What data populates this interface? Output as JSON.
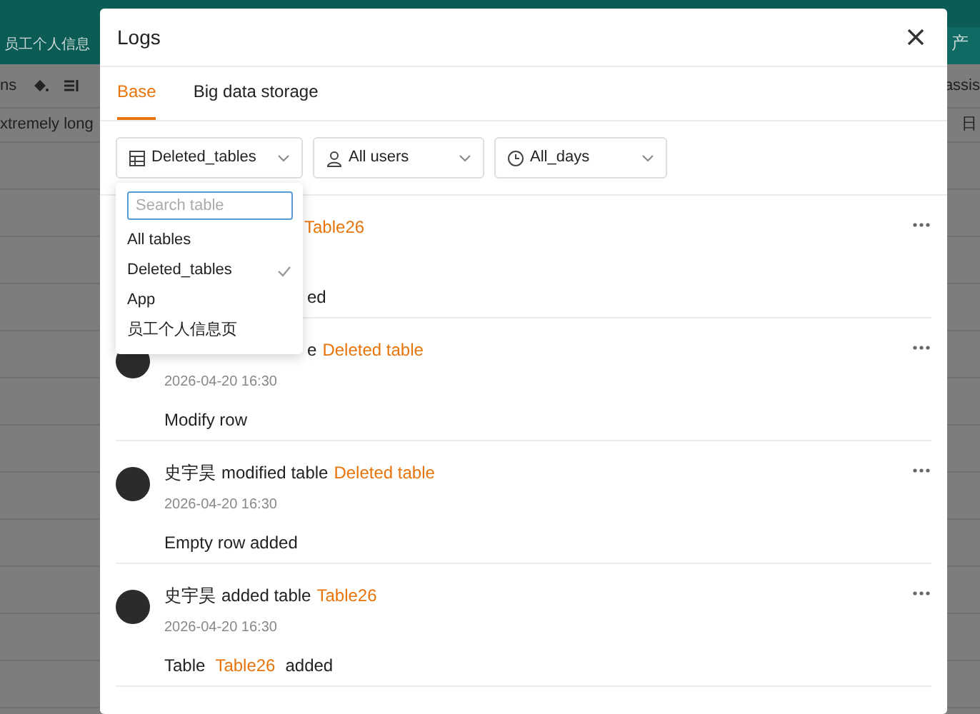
{
  "background_app": {
    "table_tab": "员工个人信息",
    "right_tab": "产",
    "toolbar_left": "ns",
    "toolbar_right": "assis",
    "column_header_left": "xtremely long",
    "column_header_right": "日"
  },
  "modal": {
    "title": "Logs",
    "tabs": [
      {
        "label": "Base",
        "selected": true
      },
      {
        "label": "Big data storage",
        "selected": false
      }
    ],
    "filters": [
      {
        "kind": "table",
        "value": "Deleted_tables"
      },
      {
        "kind": "user",
        "value": "All users"
      },
      {
        "kind": "date",
        "value": "All_days"
      }
    ],
    "table_menu": {
      "search_placeholder": "Search table",
      "options": [
        {
          "label": "All tables",
          "selected": false
        },
        {
          "label": "Deleted_tables",
          "selected": true
        },
        {
          "label": "App",
          "selected": false
        },
        {
          "label": "员工个人信息页",
          "selected": false
        }
      ]
    },
    "entries": [
      {
        "target": "Table26",
        "detail": [
          {
            "text": "ed",
            "link": false
          }
        ]
      },
      {
        "action": "e",
        "target": "Deleted table",
        "time": "2026-04-20 16:30",
        "detail": [
          {
            "text": "Modify row",
            "link": false
          }
        ]
      },
      {
        "actor": "史宇昊",
        "action": "modified table",
        "target": "Deleted table",
        "time": "2026-04-20 16:30",
        "detail": [
          {
            "text": "Empty row added",
            "link": false
          }
        ]
      },
      {
        "actor": "史宇昊",
        "action": "added table",
        "target": "Table26",
        "time": "2026-04-20 16:30",
        "detail": [
          {
            "text": "Table",
            "link": false
          },
          {
            "text": "Table26",
            "link": true
          },
          {
            "text": "added",
            "link": false
          }
        ]
      }
    ]
  }
}
